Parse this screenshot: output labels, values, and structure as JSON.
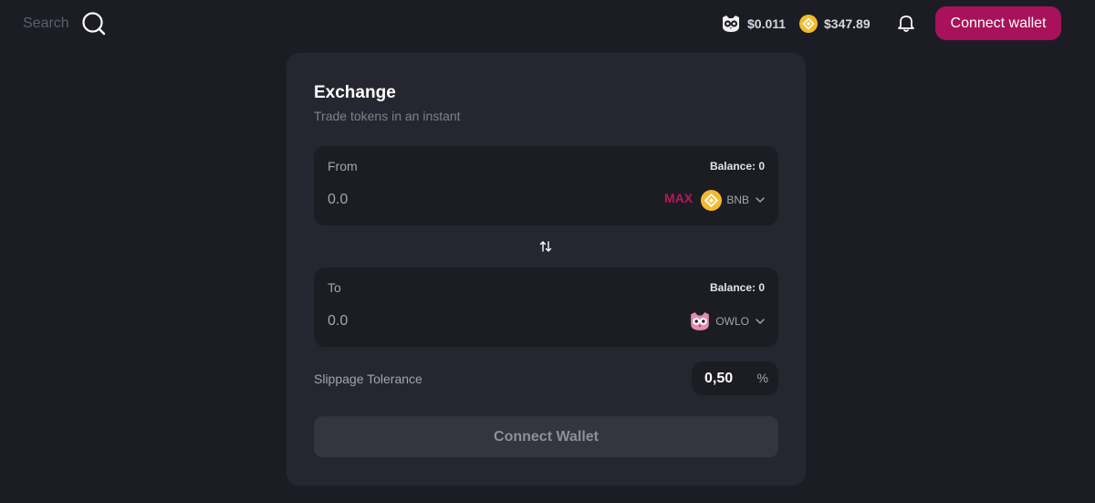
{
  "header": {
    "search": {
      "placeholder": "Search"
    },
    "prices": {
      "owl": {
        "icon": "owl-logo-icon",
        "value": "$0.011"
      },
      "bnb": {
        "icon": "bnb-logo-icon",
        "value": "$347.89"
      }
    },
    "notifications_icon": "bell-icon",
    "connect_label": "Connect wallet"
  },
  "exchange": {
    "title": "Exchange",
    "subtitle": "Trade tokens in an instant",
    "from": {
      "label": "From",
      "balance": "Balance: 0",
      "amount_placeholder": "0.0",
      "max_label": "MAX",
      "token": {
        "symbol": "BNB",
        "icon": "bnb-logo-icon"
      }
    },
    "swap_icon": "swap-arrows-icon",
    "to": {
      "label": "To",
      "balance": "Balance: 0",
      "amount_placeholder": "0.0",
      "token": {
        "symbol": "OWLO",
        "icon": "owl-logo-icon"
      }
    },
    "slippage": {
      "label": "Slippage Tolerance",
      "value": "0,50",
      "unit": "%"
    },
    "connect_label": "Connect Wallet"
  },
  "colors": {
    "background": "#1c1d24",
    "card": "#25262f",
    "panel": "#1c1d23",
    "accent": "#a8125a",
    "max": "#b5185f",
    "bnb_yellow": "#f3ba2f"
  }
}
